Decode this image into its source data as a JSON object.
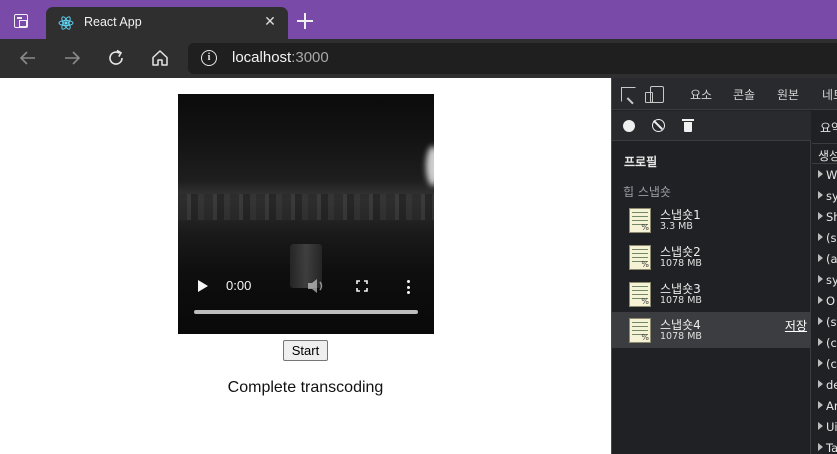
{
  "browser": {
    "tab_title": "React App",
    "tab_close_glyph": "✕",
    "address": {
      "host": "localhost",
      "port": ":3000"
    }
  },
  "page": {
    "video": {
      "time": "0:00",
      "progress": 0.0
    },
    "start_button": "Start",
    "status_text": "Complete transcoding"
  },
  "devtools": {
    "tabs": [
      "요소",
      "콘솔",
      "원본",
      "네트"
    ],
    "heading": "프로필",
    "group_label": "힙 스냅숏",
    "snapshots": [
      {
        "name": "스냅숏1",
        "size": "3.3 MB"
      },
      {
        "name": "스냅숏2",
        "size": "1078 MB"
      },
      {
        "name": "스냅숏3",
        "size": "1078 MB"
      },
      {
        "name": "스냅숏4",
        "size": "1078 MB",
        "selected": true,
        "action": "저장"
      }
    ],
    "right_panel": {
      "top": "요약",
      "header": "생성",
      "rows": [
        "W",
        "sy",
        "Sh",
        "(sy",
        "(a",
        "sy",
        "O",
        "(st",
        "(c",
        "(c",
        "de",
        "Ar",
        "Ui",
        "Ta"
      ]
    }
  },
  "colors": {
    "titlebar": "#7a4aa8",
    "toolbar": "#2f2f2f",
    "devtools_bg": "#202124",
    "snapshot_selected": "#3c3d40"
  }
}
